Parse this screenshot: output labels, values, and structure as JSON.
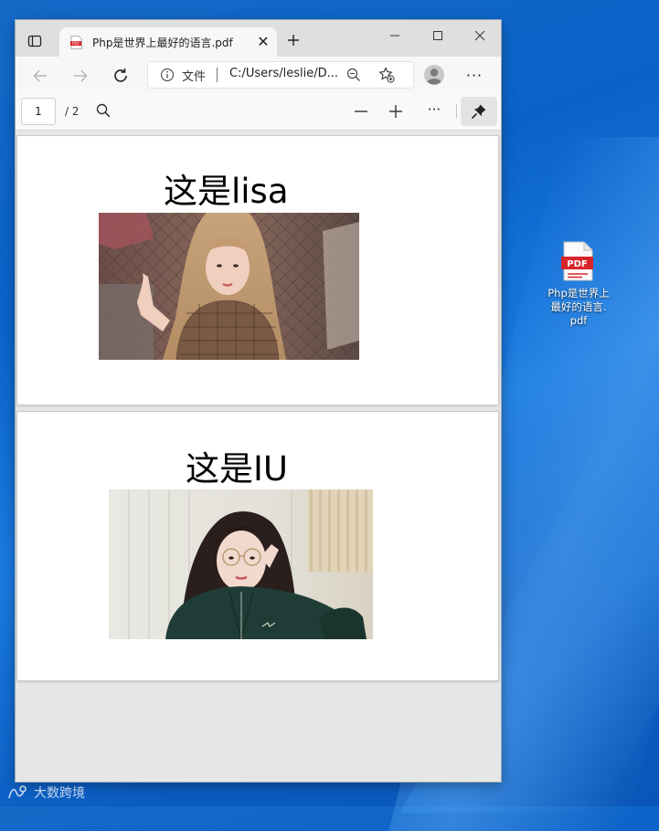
{
  "desktop": {
    "icon_label_lines": [
      "Php是世界上",
      "最好的语言.",
      "pdf"
    ],
    "watermark": "大数跨境"
  },
  "browser": {
    "tab": {
      "title": "Php是世界上最好的语言.pdf"
    },
    "address": {
      "scheme_label": "文件",
      "url": "C:/Users/leslie/D..."
    },
    "pdf_toolbar": {
      "page_current": "1",
      "page_total": "/ 2"
    }
  },
  "document": {
    "pages": [
      {
        "heading": "这是lisa",
        "image": "photo-woman-blonde-hair-plaid-dress"
      },
      {
        "heading": "这是IU",
        "image": "photo-woman-glasses-green-jacket"
      }
    ]
  },
  "colors": {
    "desktop_bg": "#0a63c9",
    "pdf_badge": "#d9252a"
  }
}
